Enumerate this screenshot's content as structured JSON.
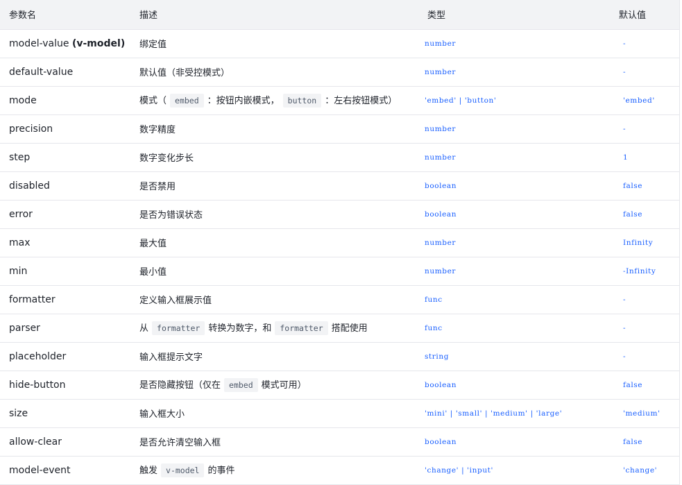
{
  "header": {
    "col_name": "参数名",
    "col_desc": "描述",
    "col_type": "类型",
    "col_default": "默认值"
  },
  "rows": [
    {
      "name": "model-value",
      "name_suffix": "(v-model)",
      "desc": "绑定值",
      "type": "number",
      "default": "-"
    },
    {
      "name": "default-value",
      "desc": "默认值（非受控模式）",
      "type": "number",
      "default": "-"
    },
    {
      "name": "mode",
      "desc_parts": [
        "模式（",
        "embed",
        "：按钮内嵌模式，",
        "button",
        "：左右按钮模式）"
      ],
      "type": "'embed' | 'button'",
      "default": "'embed'"
    },
    {
      "name": "precision",
      "desc": "数字精度",
      "type": "number",
      "default": "-"
    },
    {
      "name": "step",
      "desc": "数字变化步长",
      "type": "number",
      "default": "1"
    },
    {
      "name": "disabled",
      "desc": "是否禁用",
      "type": "boolean",
      "default": "false"
    },
    {
      "name": "error",
      "desc": "是否为错误状态",
      "type": "boolean",
      "default": "false"
    },
    {
      "name": "max",
      "desc": "最大值",
      "type": "number",
      "default": "Infinity"
    },
    {
      "name": "min",
      "desc": "最小值",
      "type": "number",
      "default": "-Infinity"
    },
    {
      "name": "formatter",
      "desc": "定义输入框展示值",
      "type": "func",
      "default": "-"
    },
    {
      "name": "parser",
      "desc_parts": [
        "从",
        "formatter",
        "转换为数字，和",
        "formatter",
        "搭配使用"
      ],
      "type": "func",
      "default": "-"
    },
    {
      "name": "placeholder",
      "desc": "输入框提示文字",
      "type": "string",
      "default": "-"
    },
    {
      "name": "hide-button",
      "desc_parts": [
        "是否隐藏按钮（仅在",
        "embed",
        "模式可用）"
      ],
      "type": "boolean",
      "default": "false"
    },
    {
      "name": "size",
      "desc": "输入框大小",
      "type": "'mini' | 'small' | 'medium' | 'large'",
      "default": "'medium'"
    },
    {
      "name": "allow-clear",
      "desc": "是否允许清空输入框",
      "type": "boolean",
      "default": "false"
    },
    {
      "name": "model-event",
      "desc_parts": [
        "触发",
        "v-model",
        "的事件"
      ],
      "type": "'change' | 'input'",
      "default": "'change'"
    }
  ],
  "colors": {
    "header_bg": "#f2f3f5",
    "border": "#e5e6eb",
    "accent_value": "#165dff",
    "text": "#1d2129",
    "code_bg": "#f2f3f5"
  }
}
